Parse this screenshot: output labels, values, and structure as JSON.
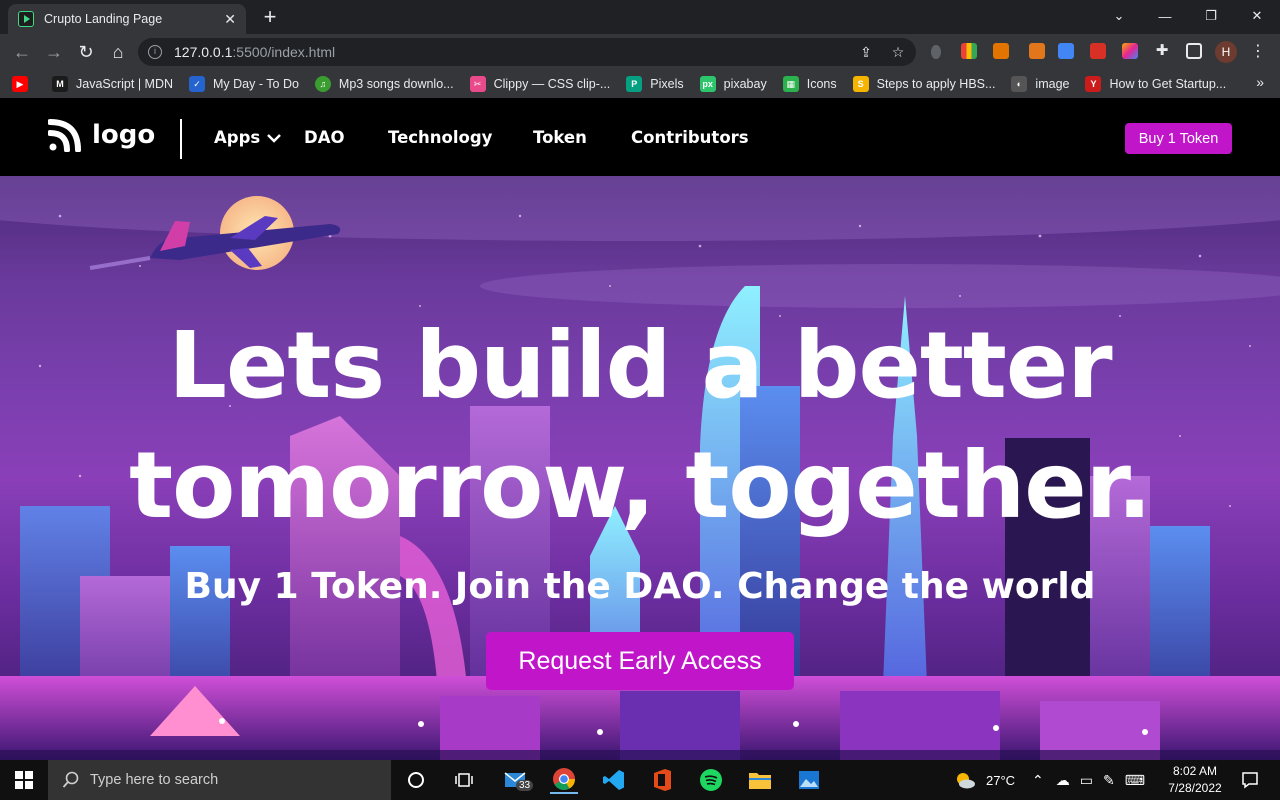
{
  "browser": {
    "tab_title": "Crupto Landing Page",
    "tab_close": "✕",
    "new_tab": "+",
    "url_host": "127.0.0.1",
    "url_rest": ":5500/index.html",
    "profile_initial": "H",
    "window_controls": {
      "minimize": "—",
      "restore": "❐",
      "close": "✕",
      "tab_search": "⌄"
    }
  },
  "bookmarks": [
    {
      "label": "JavaScript | MDN",
      "color": "#1b1b1b",
      "glyph": "M"
    },
    {
      "label": "My Day - To Do",
      "color": "#2564cf",
      "glyph": "✓"
    },
    {
      "label": "Mp3 songs downlo...",
      "color": "#3a9d2f",
      "glyph": "♫"
    },
    {
      "label": "Clippy — CSS clip-...",
      "color": "#e94b8a",
      "glyph": "✂"
    },
    {
      "label": "Pixels",
      "color": "#05a081",
      "glyph": "P"
    },
    {
      "label": "pixabay",
      "color": "#2ec66d",
      "glyph": "px"
    },
    {
      "label": "Icons",
      "color": "#2bb24c",
      "glyph": "▦"
    },
    {
      "label": "Steps to apply HBS...",
      "color": "#f4b400",
      "glyph": "S"
    },
    {
      "label": "image",
      "color": "#555555",
      "glyph": "◐"
    },
    {
      "label": "How to Get Startup...",
      "color": "#cc1b1b",
      "glyph": "Y"
    }
  ],
  "bookmarks_more": "»",
  "site": {
    "logo_text": "logo",
    "nav": {
      "apps": "Apps",
      "dao": "DAO",
      "technology": "Technology",
      "token": "Token",
      "contributors": "Contributors"
    },
    "buy_button": "Buy 1 Token"
  },
  "hero": {
    "headline_line1": "Lets build a better",
    "headline_line2": "tomorrow, together.",
    "subheadline": "Buy 1 Token. Join the DAO. Change the world",
    "cta": "Request Early Access"
  },
  "taskbar": {
    "search_placeholder": "Type here to search",
    "mail_badge": "33",
    "temperature": "27°C",
    "time": "8:02 AM",
    "date": "7/28/2022"
  },
  "colors": {
    "accent": "#c115c9",
    "nav_bg": "#000000",
    "browser_dark": "#202124",
    "browser_toolbar": "#35363a"
  }
}
